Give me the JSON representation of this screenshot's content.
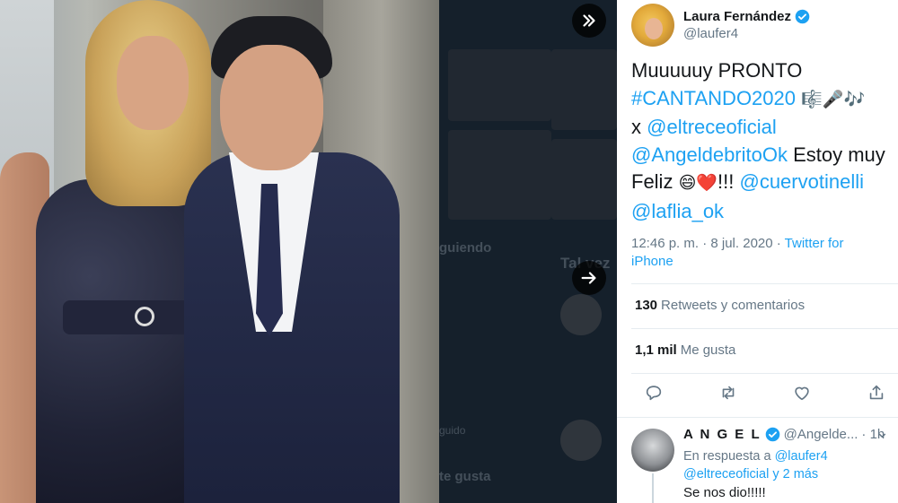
{
  "photo": {
    "alt": ""
  },
  "backdrop": {
    "ghost_texts": [
      "guiendo",
      "Tal vez",
      "guido",
      "te gusta"
    ]
  },
  "nav": {
    "collapse_icon": "chevrons-right-icon",
    "next_icon": "arrow-right-icon"
  },
  "tweet": {
    "author_name": "Laura Fernández",
    "author_handle": "@laufer4",
    "text_line1": "Muuuuuy PRONTO",
    "hashtag": "#CANTANDO2020",
    "emoji1": "🎼🎤🎶",
    "x_prefix": "x ",
    "mention1": "@eltreceoficial",
    "mention2": "@AngeldebritoOk",
    "text_mid": " Estoy muy Feliz ",
    "emoji2": "😄❤️",
    "text_bang": "!!! ",
    "mention3": "@cuervotinelli",
    "mention4": "@laflia_ok",
    "time": "12:46 p. m. · 8 jul. 2020 · ",
    "source": "Twitter for iPhone",
    "retweets_count": "130",
    "retweets_label": "Retweets y comentarios",
    "likes_count": "1,1 mil",
    "likes_label": "Me gusta"
  },
  "actions": {
    "reply_icon": "comment-icon",
    "retweet_icon": "retweet-icon",
    "like_icon": "heart-icon",
    "share_icon": "share-icon"
  },
  "reply": {
    "name": "A N G E L",
    "handle": "@Angelde...",
    "time": "· 1h",
    "more": "⌄",
    "replying_prefix": "En respuesta a ",
    "replying_to1": "@laufer4",
    "replying_to2": "@eltreceoficial",
    "replying_more": " y 2 más",
    "text": "Se nos dio!!!!!"
  },
  "colors": {
    "accent": "#1da1f2",
    "dim": "#15202b",
    "muted": "#657786"
  }
}
